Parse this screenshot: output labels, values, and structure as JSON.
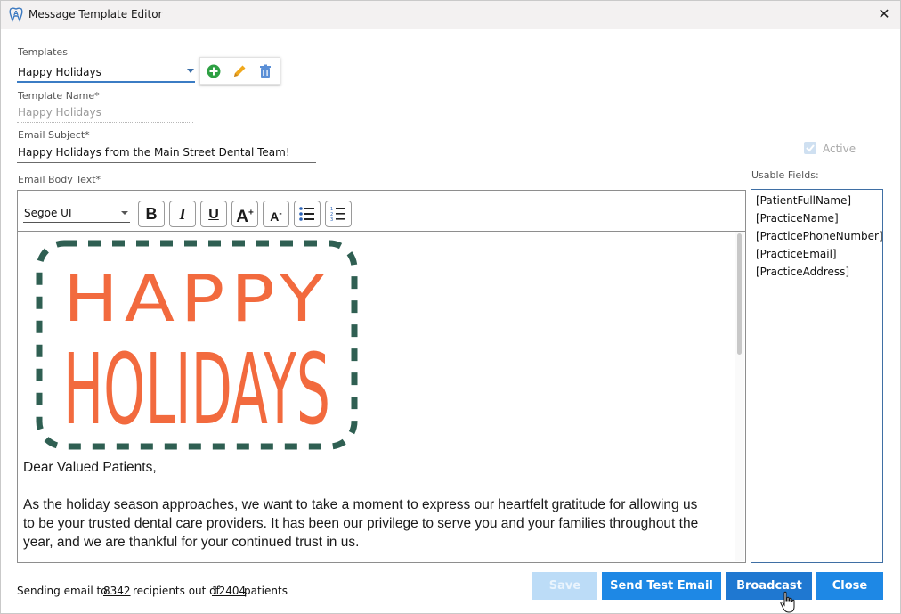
{
  "window": {
    "title": "Message Template Editor",
    "close_icon": "close-icon",
    "app_icon": "dental-tooth-icon"
  },
  "templates": {
    "label": "Templates",
    "selected": "Happy Holidays",
    "actions": {
      "add_icon": "add-circle-icon",
      "edit_icon": "pencil-icon",
      "delete_icon": "trash-icon"
    }
  },
  "template_name": {
    "label": "Template Name*",
    "value": "Happy Holidays"
  },
  "email_subject": {
    "label": "Email Subject*",
    "value": "Happy Holidays from the Main Street Dental Team!"
  },
  "active": {
    "label": "Active",
    "checked": true
  },
  "email_body": {
    "label": "Email Body Text*",
    "toolbar": {
      "font": "Segoe UI",
      "bold_icon": "bold-icon",
      "italic_icon": "italic-icon",
      "underline_icon": "underline-icon",
      "increase_font_icon": "font-size-increase-icon",
      "decrease_font_icon": "font-size-decrease-icon",
      "bullet_list_icon": "bullet-list-icon",
      "numbered_list_icon": "numbered-list-icon"
    },
    "banner_image": "happy-holidays-banner-image",
    "banner_line1": "HAPPY",
    "banner_line2": "HOLIDAYS",
    "greeting": "Dear Valued Patients,",
    "paragraph_lines": [
      "As the holiday season approaches, we want to take a moment to express our heartfelt gratitude for allowing us",
      "to be your trusted dental care providers. It has been our privilege to serve you and your families throughout the",
      "year, and we are thankful for your continued trust in us."
    ]
  },
  "usable_fields": {
    "label": "Usable Fields:",
    "items": [
      "[PatientFullName]",
      "[PracticeName]",
      "[PracticePhoneNumber]",
      "[PracticeEmail]",
      "[PracticeAddress]"
    ]
  },
  "footer": {
    "prefix": "Sending email to",
    "recipients": "8342",
    "middle": "recipients out of",
    "total": "12404",
    "suffix": "patients"
  },
  "buttons": {
    "save": "Save",
    "send_test": "Send Test Email",
    "broadcast": "Broadcast",
    "close": "Close"
  },
  "colors": {
    "accent": "#1e88e5",
    "banner_text": "#f26a3e",
    "banner_dash": "#2f5f52"
  }
}
